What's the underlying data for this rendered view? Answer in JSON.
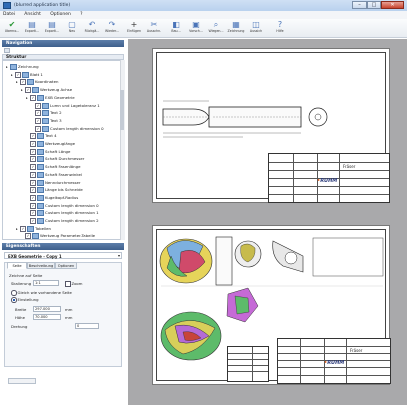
{
  "window": {
    "title": "(blurred application title)"
  },
  "menu": {
    "items": [
      "Datei",
      "Ansicht",
      "Optionen",
      "?"
    ]
  },
  "toolbar": {
    "buttons": [
      {
        "label": "Überno...",
        "icon": "checkmark-icon",
        "color": "#2e9a3a"
      },
      {
        "label": "Exporti...",
        "icon": "export-icon",
        "color": "#4a74b8"
      },
      {
        "label": "Exporti...",
        "icon": "export-icon",
        "color": "#4a74b8"
      },
      {
        "label": "Neu",
        "icon": "new-icon",
        "color": "#4a74b8"
      },
      {
        "label": "Rückgä...",
        "icon": "undo-icon",
        "color": "#4a74b8"
      },
      {
        "label": "Wieder...",
        "icon": "redo-icon",
        "color": "#4a74b8"
      },
      {
        "label": "Einfügen",
        "icon": "insert-icon",
        "color": "#333333"
      },
      {
        "label": "Ausschn.",
        "icon": "cut-icon",
        "color": "#4a74b8"
      },
      {
        "label": "Bau...",
        "icon": "part-icon",
        "color": "#4a74b8"
      },
      {
        "label": "Vorsch...",
        "icon": "preview-icon",
        "color": "#4a74b8"
      },
      {
        "label": "Wiegen...",
        "icon": "zoom-icon",
        "color": "#4a74b8"
      },
      {
        "label": "Zeichnung",
        "icon": "drawing-icon",
        "color": "#4a74b8"
      },
      {
        "label": "Aussich",
        "icon": "view-icon",
        "color": "#4a74b8"
      },
      {
        "label": "Hilfe",
        "icon": "help-icon",
        "color": "#4a74b8"
      }
    ]
  },
  "navigation": {
    "title": "Navigation"
  },
  "tree": {
    "header": "Struktur",
    "items": [
      {
        "label": "Zeichnung",
        "depth": 0,
        "checked": false
      },
      {
        "label": "Blatt 1",
        "depth": 1,
        "checked": true
      },
      {
        "label": "Koordinaten",
        "depth": 2,
        "checked": true
      },
      {
        "label": "Werkzeug Achse",
        "depth": 3,
        "checked": true
      },
      {
        "label": "EXB Geometrie",
        "depth": 4,
        "checked": true
      },
      {
        "label": "Lumn und Lagetoleranz 1",
        "depth": 5,
        "checked": true
      },
      {
        "label": "Text 2",
        "depth": 5,
        "checked": true
      },
      {
        "label": "Text 3",
        "depth": 5,
        "checked": true
      },
      {
        "label": "Custom length dimension 0",
        "depth": 5,
        "checked": true
      },
      {
        "label": "Text 4",
        "depth": 4,
        "checked": true
      },
      {
        "label": "Werkzeuglänge",
        "depth": 4,
        "checked": true
      },
      {
        "label": "Schaft Länge",
        "depth": 4,
        "checked": true
      },
      {
        "label": "Schaft Durchmesser",
        "depth": 4,
        "checked": true
      },
      {
        "label": "Schaft Fasenlänge",
        "depth": 4,
        "checked": true
      },
      {
        "label": "Schaft Fasenwinkel",
        "depth": 4,
        "checked": true
      },
      {
        "label": "Nenndurchmesser",
        "depth": 4,
        "checked": true
      },
      {
        "label": "Länge bis Schneide",
        "depth": 4,
        "checked": true
      },
      {
        "label": "Kugelkopf-Radius",
        "depth": 4,
        "checked": true
      },
      {
        "label": "Custom length dimension 0",
        "depth": 4,
        "checked": true
      },
      {
        "label": "Custom length dimension 1",
        "depth": 4,
        "checked": true
      },
      {
        "label": "Custom length dimension 2",
        "depth": 4,
        "checked": true
      },
      {
        "label": "Tabellen",
        "depth": 2,
        "checked": true
      },
      {
        "label": "Werkzeug Parameter-Tabelle",
        "depth": 3,
        "checked": true
      }
    ]
  },
  "properties": {
    "title": "Eigenschaften",
    "selected": "EXB Geometrie - Copy 1",
    "tabs": [
      "Seite",
      "Beschreibung",
      "Optionen"
    ],
    "group_label": "Zeichne auf Seite",
    "skalierung_label": "Skalierung",
    "skalierung_value": "1:1",
    "zoom_label": "Zoom",
    "option_1": "Gleich wie vorhandene Seite",
    "option_2": "Einstellung",
    "breite_label": "Breite",
    "breite_value": "297.000",
    "hoehe_label": "Höhe",
    "hoehe_value": "70.000",
    "unit": "mm",
    "drehung_label": "Drehung",
    "drehung_value": "0"
  },
  "drawings": {
    "sheet1": {
      "company": "RUHM",
      "tool_name": "Fräser"
    },
    "sheet2": {
      "company": "RUHM",
      "tool_name": "Fräser"
    }
  }
}
